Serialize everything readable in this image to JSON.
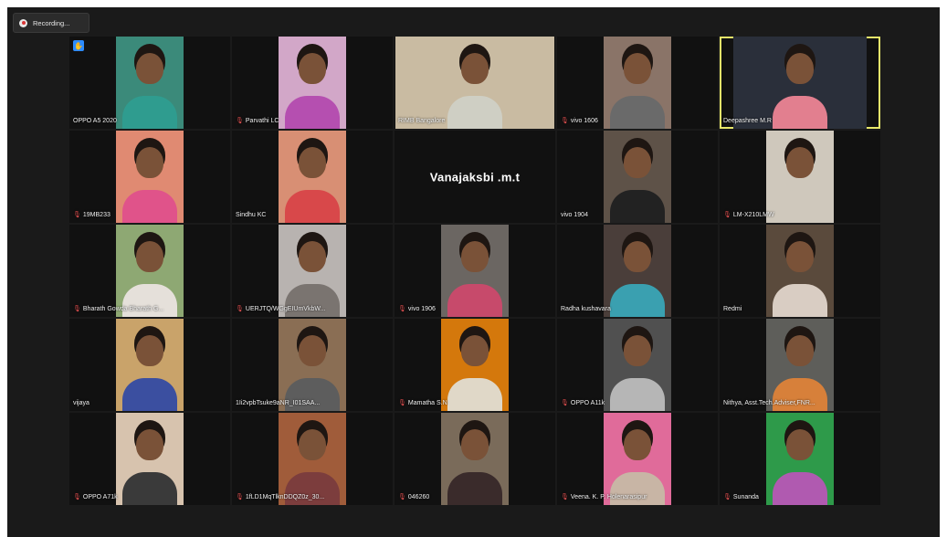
{
  "recording": {
    "label": "Recording..."
  },
  "main": {
    "center_tile_name": "Vanajaksbi .m.t",
    "raised_hand_icon": "hand-icon",
    "muted_icon": "mic-muted-icon",
    "accent_active_speaker": "#e8e86a",
    "participants": [
      {
        "name": "OPPO A5 2020",
        "muted": false,
        "hand": true,
        "bg": "#3b8a7a",
        "shirt": "#2f9c8f"
      },
      {
        "name": "Parvathi LC",
        "muted": true,
        "hand": false,
        "bg": "#d2a7c8",
        "shirt": "#b54fb0"
      },
      {
        "name": "RIMB Bangalore",
        "muted": false,
        "hand": false,
        "bg": "#c9bba2",
        "shirt": "#cfcfc4",
        "wide": true
      },
      {
        "name": "vivo 1606",
        "muted": true,
        "hand": false,
        "bg": "#8a7468",
        "shirt": "#6a6a6a"
      },
      {
        "name": "Deepashree M.R",
        "muted": false,
        "hand": false,
        "bg": "#2a2f3a",
        "shirt": "#e27f8f",
        "active": true,
        "mid": true
      },
      {
        "name": "19MB233",
        "muted": true,
        "hand": false,
        "bg": "#e08a72",
        "shirt": "#e0538a"
      },
      {
        "name": "Sindhu KC",
        "muted": false,
        "hand": false,
        "bg": "#d88f74",
        "shirt": "#d8484a"
      },
      {
        "name": "",
        "center": true
      },
      {
        "name": "vivo 1904",
        "muted": false,
        "hand": false,
        "bg": "#5e5248",
        "shirt": "#222222"
      },
      {
        "name": "LM-X210LMW",
        "muted": true,
        "hand": false,
        "bg": "#cfc8bc",
        "shirt": "#cfc8bc"
      },
      {
        "name": "Bharath Gowda Bharath G...",
        "muted": true,
        "hand": false,
        "bg": "#8ea873",
        "shirt": "#e5e0da"
      },
      {
        "name": "UERJTQ/WGgEIUmVkbW...",
        "muted": true,
        "hand": false,
        "bg": "#b8b3b0",
        "shirt": "#7a7470"
      },
      {
        "name": "vivo 1906",
        "muted": true,
        "hand": false,
        "bg": "#6b6662",
        "shirt": "#c74a6b"
      },
      {
        "name": "Radha kushavara",
        "muted": false,
        "hand": false,
        "bg": "#4a3e3a",
        "shirt": "#3aa0b0"
      },
      {
        "name": "Redmi",
        "muted": false,
        "hand": false,
        "bg": "#5a4a3c",
        "shirt": "#d9cdc3"
      },
      {
        "name": "vijaya",
        "muted": false,
        "hand": false,
        "bg": "#c9a36a",
        "shirt": "#3b4fa0"
      },
      {
        "name": "1Ii2vpbTsuke9aNR_I01SAA...",
        "muted": false,
        "hand": false,
        "bg": "#8a6e54",
        "shirt": "#5d5d5d"
      },
      {
        "name": "Mamatha S.N",
        "muted": true,
        "hand": false,
        "bg": "#d4780c",
        "shirt": "#e0d8c8"
      },
      {
        "name": "OPPO A11k",
        "muted": true,
        "hand": false,
        "bg": "#505050",
        "shirt": "#b6b6b6"
      },
      {
        "name": "Nithya, Asst.Tech.Adviser,FNR...",
        "muted": false,
        "hand": false,
        "bg": "#5e5e5a",
        "shirt": "#d7803a"
      },
      {
        "name": "OPPO A71k",
        "muted": true,
        "hand": false,
        "bg": "#d7c3ae",
        "shirt": "#3a3a3a"
      },
      {
        "name": "1fLD1MqTlknDDQZ0z_30...",
        "muted": true,
        "hand": false,
        "bg": "#a05c3a",
        "shirt": "#7c3d3d"
      },
      {
        "name": "046260",
        "muted": true,
        "hand": false,
        "bg": "#7a6b5a",
        "shirt": "#3a2b2b"
      },
      {
        "name": "Veena. K. P. Holenarasipur",
        "muted": true,
        "hand": false,
        "bg": "#e06b9a",
        "shirt": "#c8b5a5"
      },
      {
        "name": "Sunanda",
        "muted": true,
        "hand": false,
        "bg": "#2e9a4a",
        "shirt": "#b05ab0"
      }
    ]
  }
}
